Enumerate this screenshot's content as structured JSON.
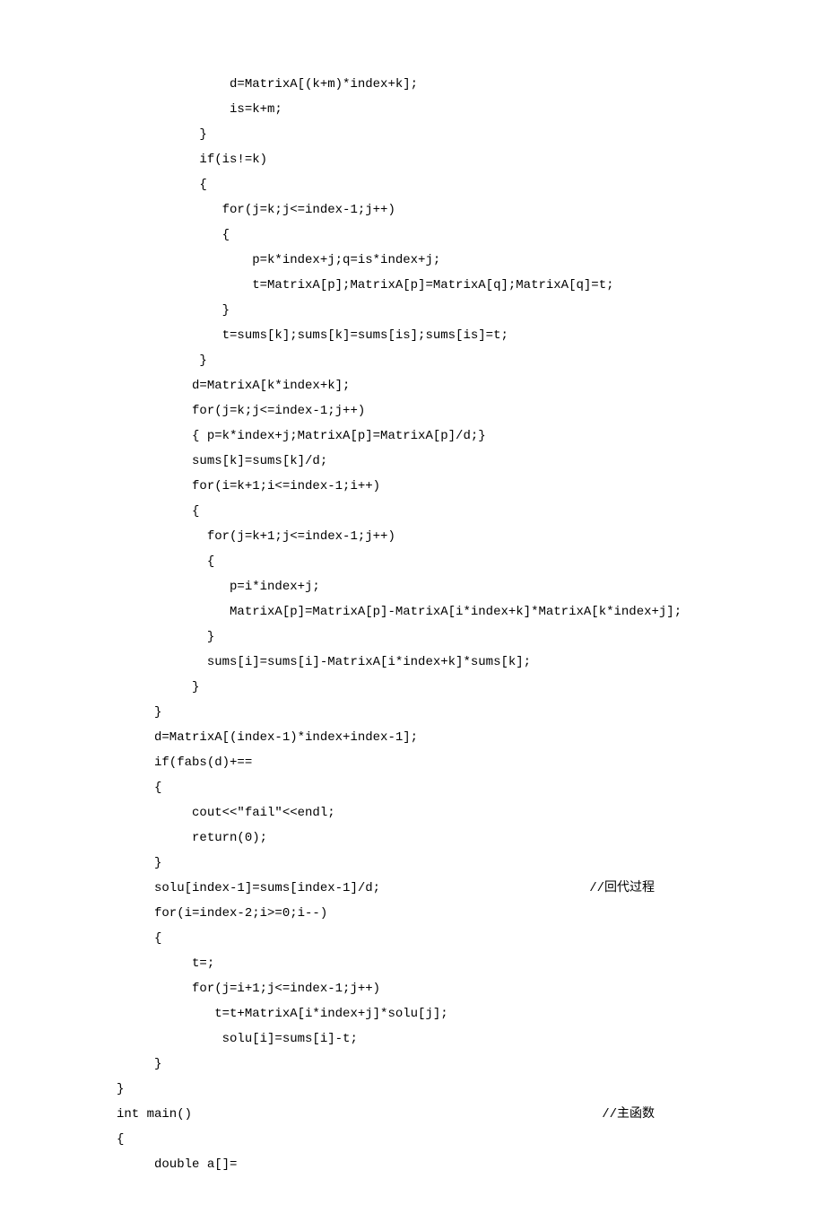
{
  "code": {
    "lines": [
      {
        "indent": "               ",
        "text": "d=MatrixA[(k+m)*index+k];"
      },
      {
        "indent": "               ",
        "text": "is=k+m;"
      },
      {
        "indent": "           ",
        "text": "}"
      },
      {
        "indent": "           ",
        "text": "if(is!=k)"
      },
      {
        "indent": "           ",
        "text": "{"
      },
      {
        "indent": "              ",
        "text": "for(j=k;j<=index-1;j++)"
      },
      {
        "indent": "              ",
        "text": "{"
      },
      {
        "indent": "                  ",
        "text": "p=k*index+j;q=is*index+j;"
      },
      {
        "indent": "                  ",
        "text": "t=MatrixA[p];MatrixA[p]=MatrixA[q];MatrixA[q]=t;"
      },
      {
        "indent": "              ",
        "text": "}"
      },
      {
        "indent": "              ",
        "text": "t=sums[k];sums[k]=sums[is];sums[is]=t;"
      },
      {
        "indent": "           ",
        "text": "}"
      },
      {
        "indent": "          ",
        "text": "d=MatrixA[k*index+k];"
      },
      {
        "indent": "          ",
        "text": "for(j=k;j<=index-1;j++)"
      },
      {
        "indent": "          ",
        "text": "{ p=k*index+j;MatrixA[p]=MatrixA[p]/d;}"
      },
      {
        "indent": "          ",
        "text": "sums[k]=sums[k]/d;"
      },
      {
        "indent": "          ",
        "text": "for(i=k+1;i<=index-1;i++)"
      },
      {
        "indent": "          ",
        "text": "{"
      },
      {
        "indent": "            ",
        "text": "for(j=k+1;j<=index-1;j++)"
      },
      {
        "indent": "            ",
        "text": "{"
      },
      {
        "indent": "               ",
        "text": "p=i*index+j;"
      },
      {
        "indent": "               ",
        "text": "MatrixA[p]=MatrixA[p]-MatrixA[i*index+k]*MatrixA[k*index+j];"
      },
      {
        "indent": "            ",
        "text": "}"
      },
      {
        "indent": "            ",
        "text": "sums[i]=sums[i]-MatrixA[i*index+k]*sums[k];"
      },
      {
        "indent": "          ",
        "text": "}"
      },
      {
        "indent": "     ",
        "text": "}"
      },
      {
        "indent": "     ",
        "text": "d=MatrixA[(index-1)*index+index-1];"
      },
      {
        "indent": "     ",
        "text": "if(fabs(d)+=="
      },
      {
        "indent": "     ",
        "text": "{"
      },
      {
        "indent": "          ",
        "text": "cout<<\"fail\"<<endl;"
      },
      {
        "indent": "          ",
        "text": "return(0);"
      },
      {
        "indent": "     ",
        "text": "}"
      },
      {
        "indent": "     ",
        "text": "solu[index-1]=sums[index-1]/d;",
        "comment": "//回代过程"
      },
      {
        "indent": "     ",
        "text": "for(i=index-2;i>=0;i--)"
      },
      {
        "indent": "     ",
        "text": "{"
      },
      {
        "indent": "          ",
        "text": "t=;"
      },
      {
        "indent": "          ",
        "text": "for(j=i+1;j<=index-1;j++)"
      },
      {
        "indent": "             ",
        "text": "t=t+MatrixA[i*index+j]*solu[j];"
      },
      {
        "indent": "              ",
        "text": "solu[i]=sums[i]-t;"
      },
      {
        "indent": "     ",
        "text": "}"
      },
      {
        "indent": "",
        "text": "}"
      },
      {
        "indent": "",
        "text": "int main()",
        "comment": "//主函数"
      },
      {
        "indent": "",
        "text": "{"
      },
      {
        "indent": "     ",
        "text": "double a[]="
      }
    ]
  }
}
